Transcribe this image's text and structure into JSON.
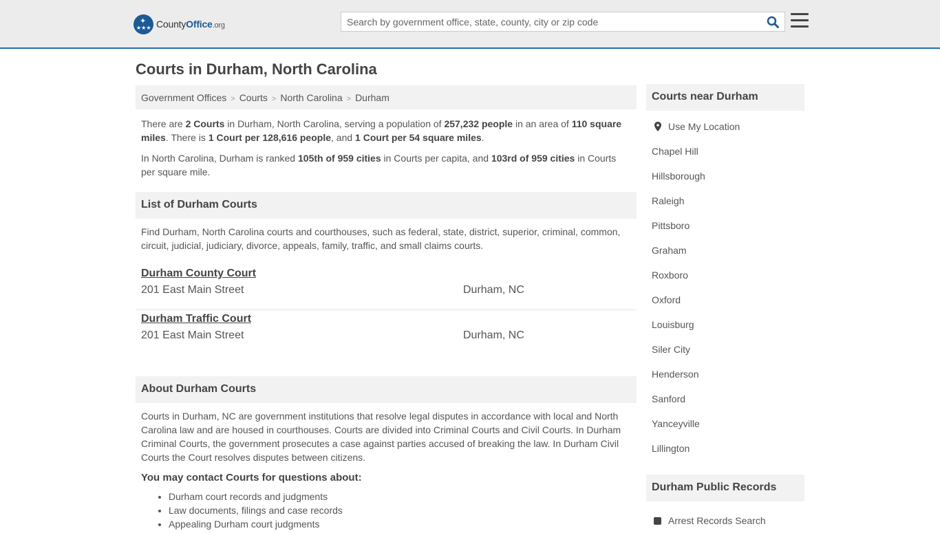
{
  "header": {
    "logo_county": "County",
    "logo_office": "Office",
    "logo_org": ".org",
    "search_placeholder": "Search by government office, state, county, city or zip code"
  },
  "page_title": "Courts in Durham, North Carolina",
  "breadcrumb": [
    "Government Offices",
    "Courts",
    "North Carolina",
    "Durham"
  ],
  "intro": {
    "p1": {
      "t1": "There are ",
      "b1": "2 Courts",
      "t2": " in Durham, North Carolina, serving a population of ",
      "b2": "257,232 people",
      "t3": " in an area of ",
      "b3": "110 square miles",
      "t4": ". There is ",
      "b4": "1 Court per 128,616 people",
      "t5": ", and ",
      "b5": "1 Court per 54 square miles",
      "t6": "."
    },
    "p2": {
      "t1": "In North Carolina, Durham is ranked ",
      "b1": "105th of 959 cities",
      "t2": " in Courts per capita, and ",
      "b2": "103rd of 959 cities",
      "t3": " in Courts per square mile."
    }
  },
  "list_section": {
    "heading": "List of Durham Courts",
    "description": "Find Durham, North Carolina courts and courthouses, such as federal, state, district, superior, criminal, common, circuit, judicial, judiciary, divorce, appeals, family, traffic, and small claims courts.",
    "courts": [
      {
        "name": "Durham County Court",
        "address": "201 East Main Street",
        "city": "Durham, NC"
      },
      {
        "name": "Durham Traffic Court",
        "address": "201 East Main Street",
        "city": "Durham, NC"
      }
    ]
  },
  "about_section": {
    "heading": "About Durham Courts",
    "text": "Courts in Durham, NC are government institutions that resolve legal disputes in accordance with local and North Carolina law and are housed in courthouses. Courts are divided into Criminal Courts and Civil Courts. In Durham Criminal Courts, the government prosecutes a case against parties accused of breaking the law. In Durham Civil Courts the Court resolves disputes between citizens.",
    "contact_heading": "You may contact Courts for questions about:",
    "bullets": [
      "Durham court records and judgments",
      "Law documents, filings and case records",
      "Appealing Durham court judgments"
    ]
  },
  "sidebar": {
    "nearby_heading": "Courts near Durham",
    "use_location": "Use My Location",
    "cities": [
      "Chapel Hill",
      "Hillsborough",
      "Raleigh",
      "Pittsboro",
      "Graham",
      "Roxboro",
      "Oxford",
      "Louisburg",
      "Siler City",
      "Henderson",
      "Sanford",
      "Yanceyville",
      "Lillington"
    ],
    "records_heading": "Durham Public Records",
    "records_items": [
      "Arrest Records Search"
    ]
  },
  "colors": {
    "accent": "#1c6fb5",
    "header_bg": "#ececec",
    "section_bg": "#f2f2f2"
  }
}
